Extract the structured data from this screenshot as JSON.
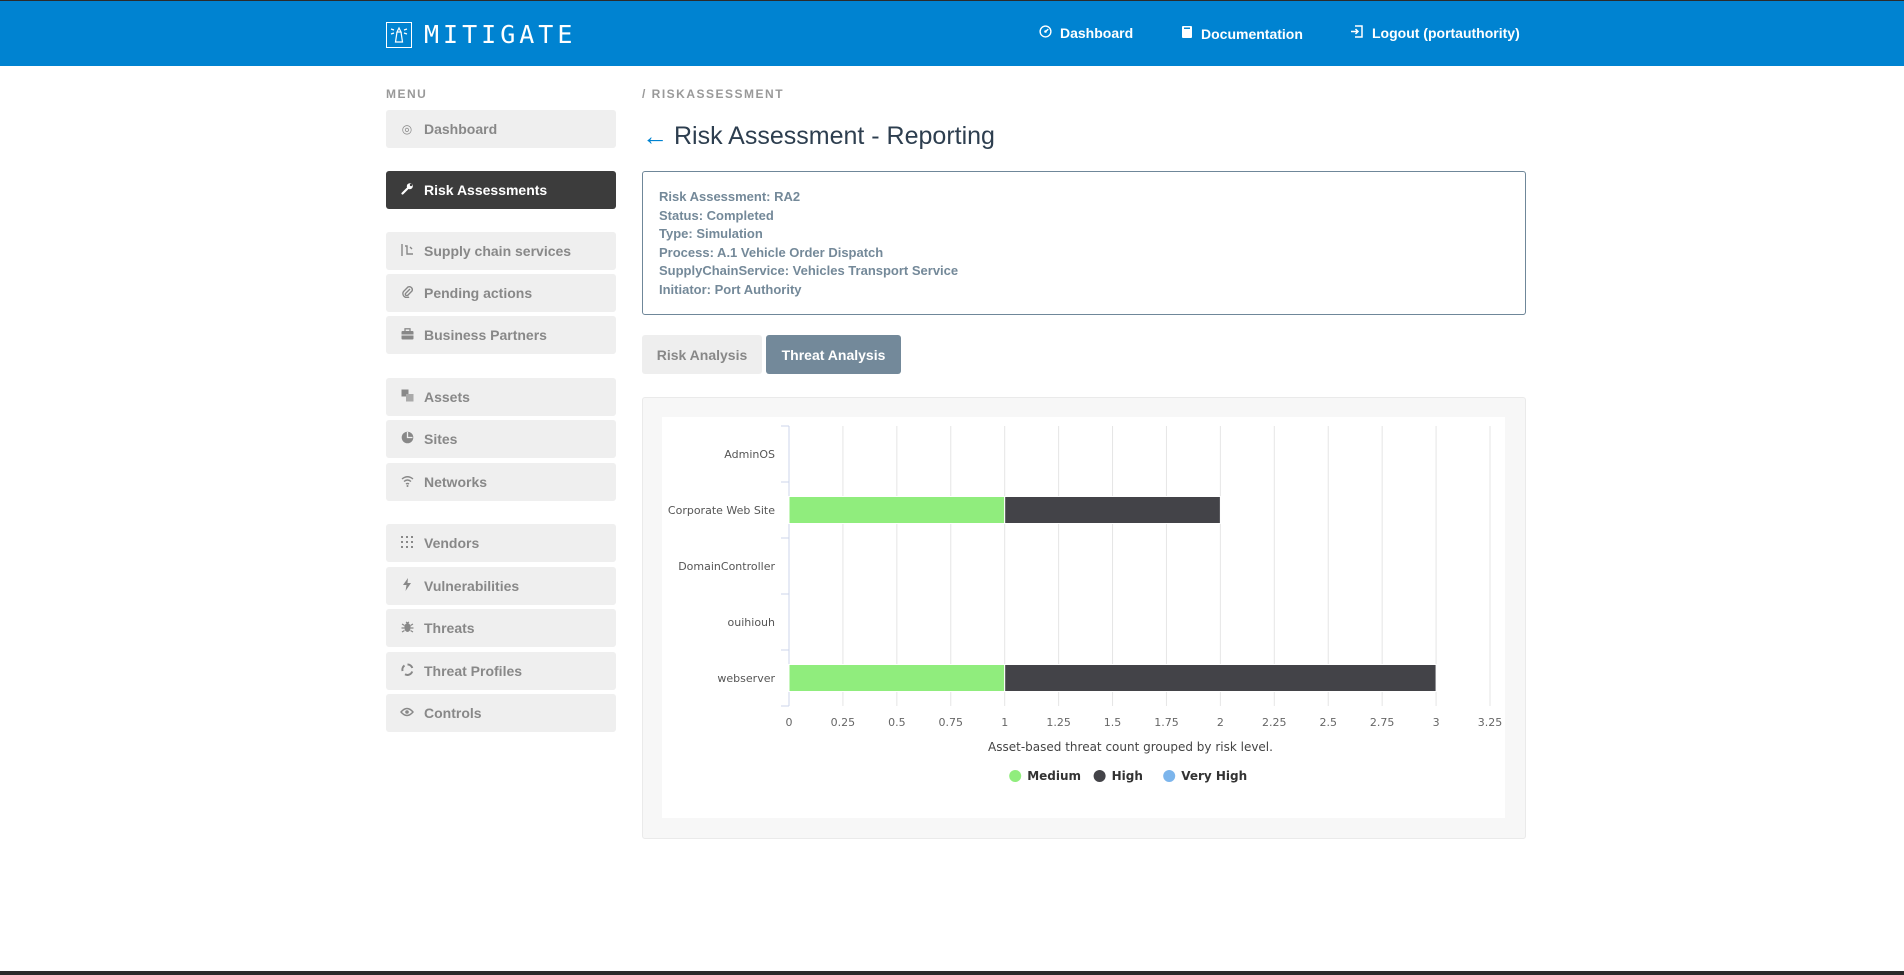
{
  "header": {
    "brand": "MITIGATE",
    "nav": [
      {
        "label": "Dashboard",
        "icon": "dashboard-icon"
      },
      {
        "label": "Documentation",
        "icon": "book-icon"
      },
      {
        "label": "Logout (portauthority)",
        "icon": "logout-icon"
      }
    ]
  },
  "sidebar": {
    "heading": "MENU",
    "items": [
      {
        "label": "Dashboard",
        "icon": "dashboard-icon"
      },
      {
        "label": "Risk Assessments",
        "icon": "wrench-icon",
        "active": true
      },
      {
        "label": "Supply chain services",
        "icon": "supply-chain-icon"
      },
      {
        "label": "Pending actions",
        "icon": "paperclip-icon"
      },
      {
        "label": "Business Partners",
        "icon": "briefcase-icon"
      },
      {
        "label": "Assets",
        "icon": "assets-icon"
      },
      {
        "label": "Sites",
        "icon": "globe-icon"
      },
      {
        "label": "Networks",
        "icon": "wifi-icon"
      },
      {
        "label": "Vendors",
        "icon": "grid-icon"
      },
      {
        "label": "Vulnerabilities",
        "icon": "bolt-icon"
      },
      {
        "label": "Threats",
        "icon": "bug-icon"
      },
      {
        "label": "Threat Profiles",
        "icon": "recycle-icon"
      },
      {
        "label": "Controls",
        "icon": "eye-icon"
      }
    ]
  },
  "breadcrumb": "/ RISKASSESSMENT",
  "page": {
    "back_arrow": "←",
    "title": "Risk Assessment - Reporting"
  },
  "info": {
    "lines": [
      "Risk Assessment: RA2",
      "Status: Completed",
      "Type: Simulation",
      "Process: A.1 Vehicle Order Dispatch",
      "SupplyChainService: Vehicles Transport Service",
      "Initiator: Port Authority"
    ]
  },
  "tabs": [
    {
      "label": "Risk Analysis",
      "active": false
    },
    {
      "label": "Threat Analysis",
      "active": true
    }
  ],
  "chart_data": {
    "type": "bar",
    "orientation": "horizontal",
    "stacked": true,
    "categories": [
      "AdminOS",
      "Corporate Web Site",
      "DomainController",
      "ouihiouh",
      "webserver"
    ],
    "series": [
      {
        "name": "Medium",
        "color": "#90ed7d",
        "values": [
          0,
          1,
          0,
          0,
          1
        ]
      },
      {
        "name": "High",
        "color": "#434348",
        "values": [
          0,
          1,
          0,
          0,
          2
        ]
      },
      {
        "name": "Very High",
        "color": "#7cb5ec",
        "values": [
          0,
          0,
          0,
          0,
          0
        ]
      }
    ],
    "xlim": [
      0,
      3.25
    ],
    "xticks": [
      "0",
      "0.25",
      "0.5",
      "0.75",
      "1",
      "1.25",
      "1.5",
      "1.75",
      "2",
      "2.25",
      "2.5",
      "2.75",
      "3",
      "3.25"
    ],
    "xlabel": "Asset-based threat count grouped by risk level.",
    "grid": true,
    "legend": "bottom-center"
  }
}
